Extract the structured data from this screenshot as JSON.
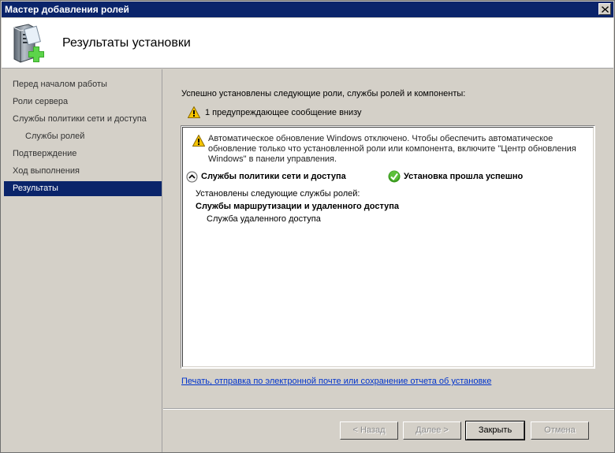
{
  "window": {
    "title": "Мастер добавления ролей"
  },
  "header": {
    "title": "Результаты установки"
  },
  "sidebar": {
    "items": [
      {
        "label": "Перед началом работы"
      },
      {
        "label": "Роли сервера"
      },
      {
        "label": "Службы политики сети и доступа"
      },
      {
        "label": "Службы ролей"
      },
      {
        "label": "Подтверждение"
      },
      {
        "label": "Ход выполнения"
      },
      {
        "label": "Результаты"
      }
    ],
    "active_index": 6
  },
  "content": {
    "intro": "Успешно установлены следующие роли, службы ролей и компоненты:",
    "warning_summary": "1 предупреждающее сообщение внизу",
    "update_warning": "Автоматическое обновление Windows отключено. Чтобы обеспечить автоматическое обновление только что установленной роли или компонента, включите \"Центр обновления Windows\" в панели управления.",
    "role_name": "Службы политики сети и доступа",
    "role_status": "Установка прошла успешно",
    "installed_label": "Установлены следующие службы ролей:",
    "installed_group": "Службы маршрутизации и удаленного доступа",
    "installed_item": "Служба удаленного доступа",
    "report_link": "Печать, отправка по электронной почте или сохранение отчета об установке"
  },
  "buttons": {
    "back": "< Назад",
    "next": "Далее >",
    "close": "Закрыть",
    "cancel": "Отмена"
  },
  "colors": {
    "titlebar": "#0a246a",
    "active_nav": "#0a246a",
    "link": "#0033cc",
    "warning": "#f5c400",
    "success": "#3a9a1e"
  },
  "icons": {
    "header": "server-add-role-icon",
    "warning": "warning-icon",
    "collapse": "chevron-up-circle-icon",
    "success": "checkmark-icon",
    "close": "close-icon"
  }
}
